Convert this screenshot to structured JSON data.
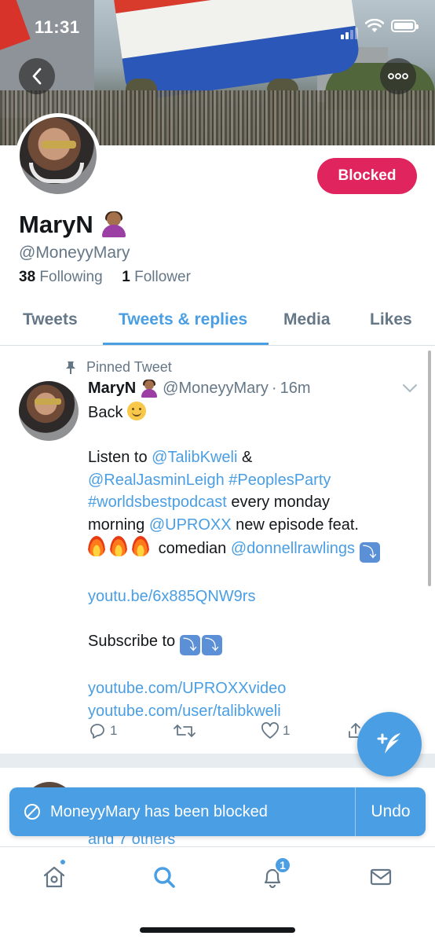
{
  "status_bar": {
    "time": "11:31"
  },
  "profile": {
    "action_button": "Blocked",
    "display_name": "MaryN",
    "handle": "@MoneyyMary",
    "following_count": "38",
    "following_label": "Following",
    "followers_count": "1",
    "followers_label": "Follower"
  },
  "tabs": [
    {
      "label": "Tweets"
    },
    {
      "label": "Tweets & replies",
      "active": true
    },
    {
      "label": "Media"
    },
    {
      "label": "Likes"
    }
  ],
  "tweet": {
    "pinned_label": "Pinned Tweet",
    "author_name": "MaryN",
    "author_handle": "@MoneyyMary",
    "separator": "·",
    "time": "16m",
    "line_back": "Back",
    "listen_to": "Listen to",
    "mention_talib": "@TalibKweli",
    "amp": "&",
    "mention_jasmin": "@RealJasminLeigh",
    "hashtag_peoples": "#PeoplesParty",
    "hashtag_worlds": "#worldsbestpodcast",
    "every_monday": "every monday",
    "morning": "morning",
    "mention_uproxx": "@UPROXX",
    "new_episode": "new episode feat.",
    "comedian": "comedian",
    "mention_donnell": "@donnellrawlings",
    "link_youtu": "youtu.be/6x885QNW9rs",
    "subscribe_to": "Subscribe to",
    "link_uproxx": "youtube.com/UPROXXvideo",
    "link_talib": "youtube.com/user/talibkweli",
    "reply_count": "1",
    "like_count": "1"
  },
  "next_tweet": {
    "peek_text": "and 7 others"
  },
  "toast": {
    "message": "MoneyyMary has been blocked",
    "undo_label": "Undo"
  },
  "bottom_nav": {
    "notification_badge": "1"
  },
  "colors": {
    "accent": "#4a9ee3",
    "blocked": "#e0245e",
    "secondary_text": "#657786"
  }
}
